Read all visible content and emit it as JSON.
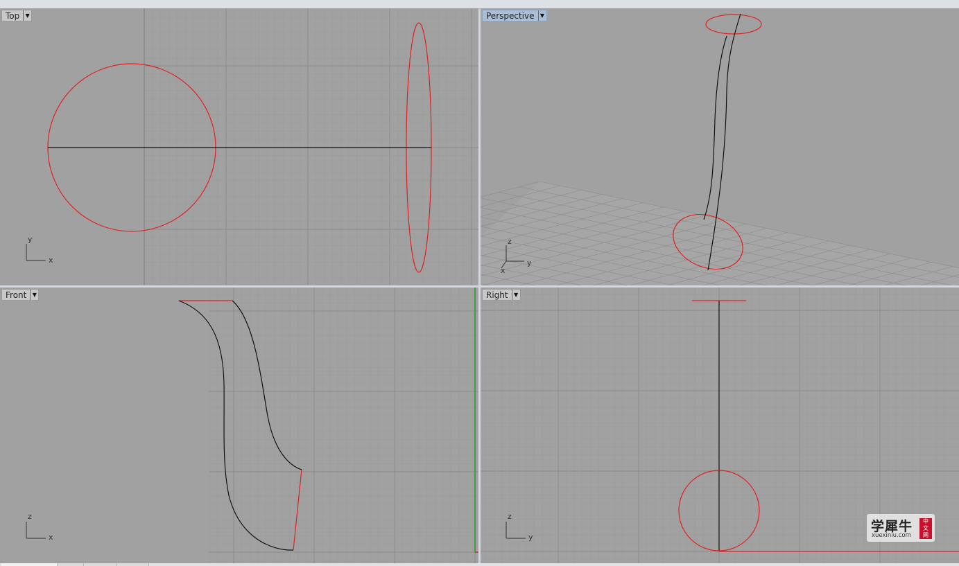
{
  "viewports": {
    "top": {
      "label": "Top",
      "axis_v": "y",
      "axis_h": "x"
    },
    "perspective": {
      "label": "Perspective",
      "axis_z": "z",
      "axis_y": "y",
      "axis_x": "x"
    },
    "front": {
      "label": "Front",
      "axis_v": "z",
      "axis_h": "x"
    },
    "right": {
      "label": "Right",
      "axis_v": "z",
      "axis_h": "y"
    }
  },
  "icons": {
    "viewport_menu": "dropdown-arrow-icon"
  },
  "colors": {
    "viewport_bg": "#a1a1a1",
    "grid_minor": "#9a9a9a",
    "grid_major": "#8a8a8a",
    "curve_selected": "#e02020",
    "curve_default": "#111111",
    "axis_green": "#2a9a2a",
    "active_tab": "#a9bfd8"
  },
  "watermark": {
    "cn": "学犀牛",
    "url": "xuexiniu.com",
    "badge_1": "中",
    "badge_2": "文",
    "badge_3": "网"
  }
}
